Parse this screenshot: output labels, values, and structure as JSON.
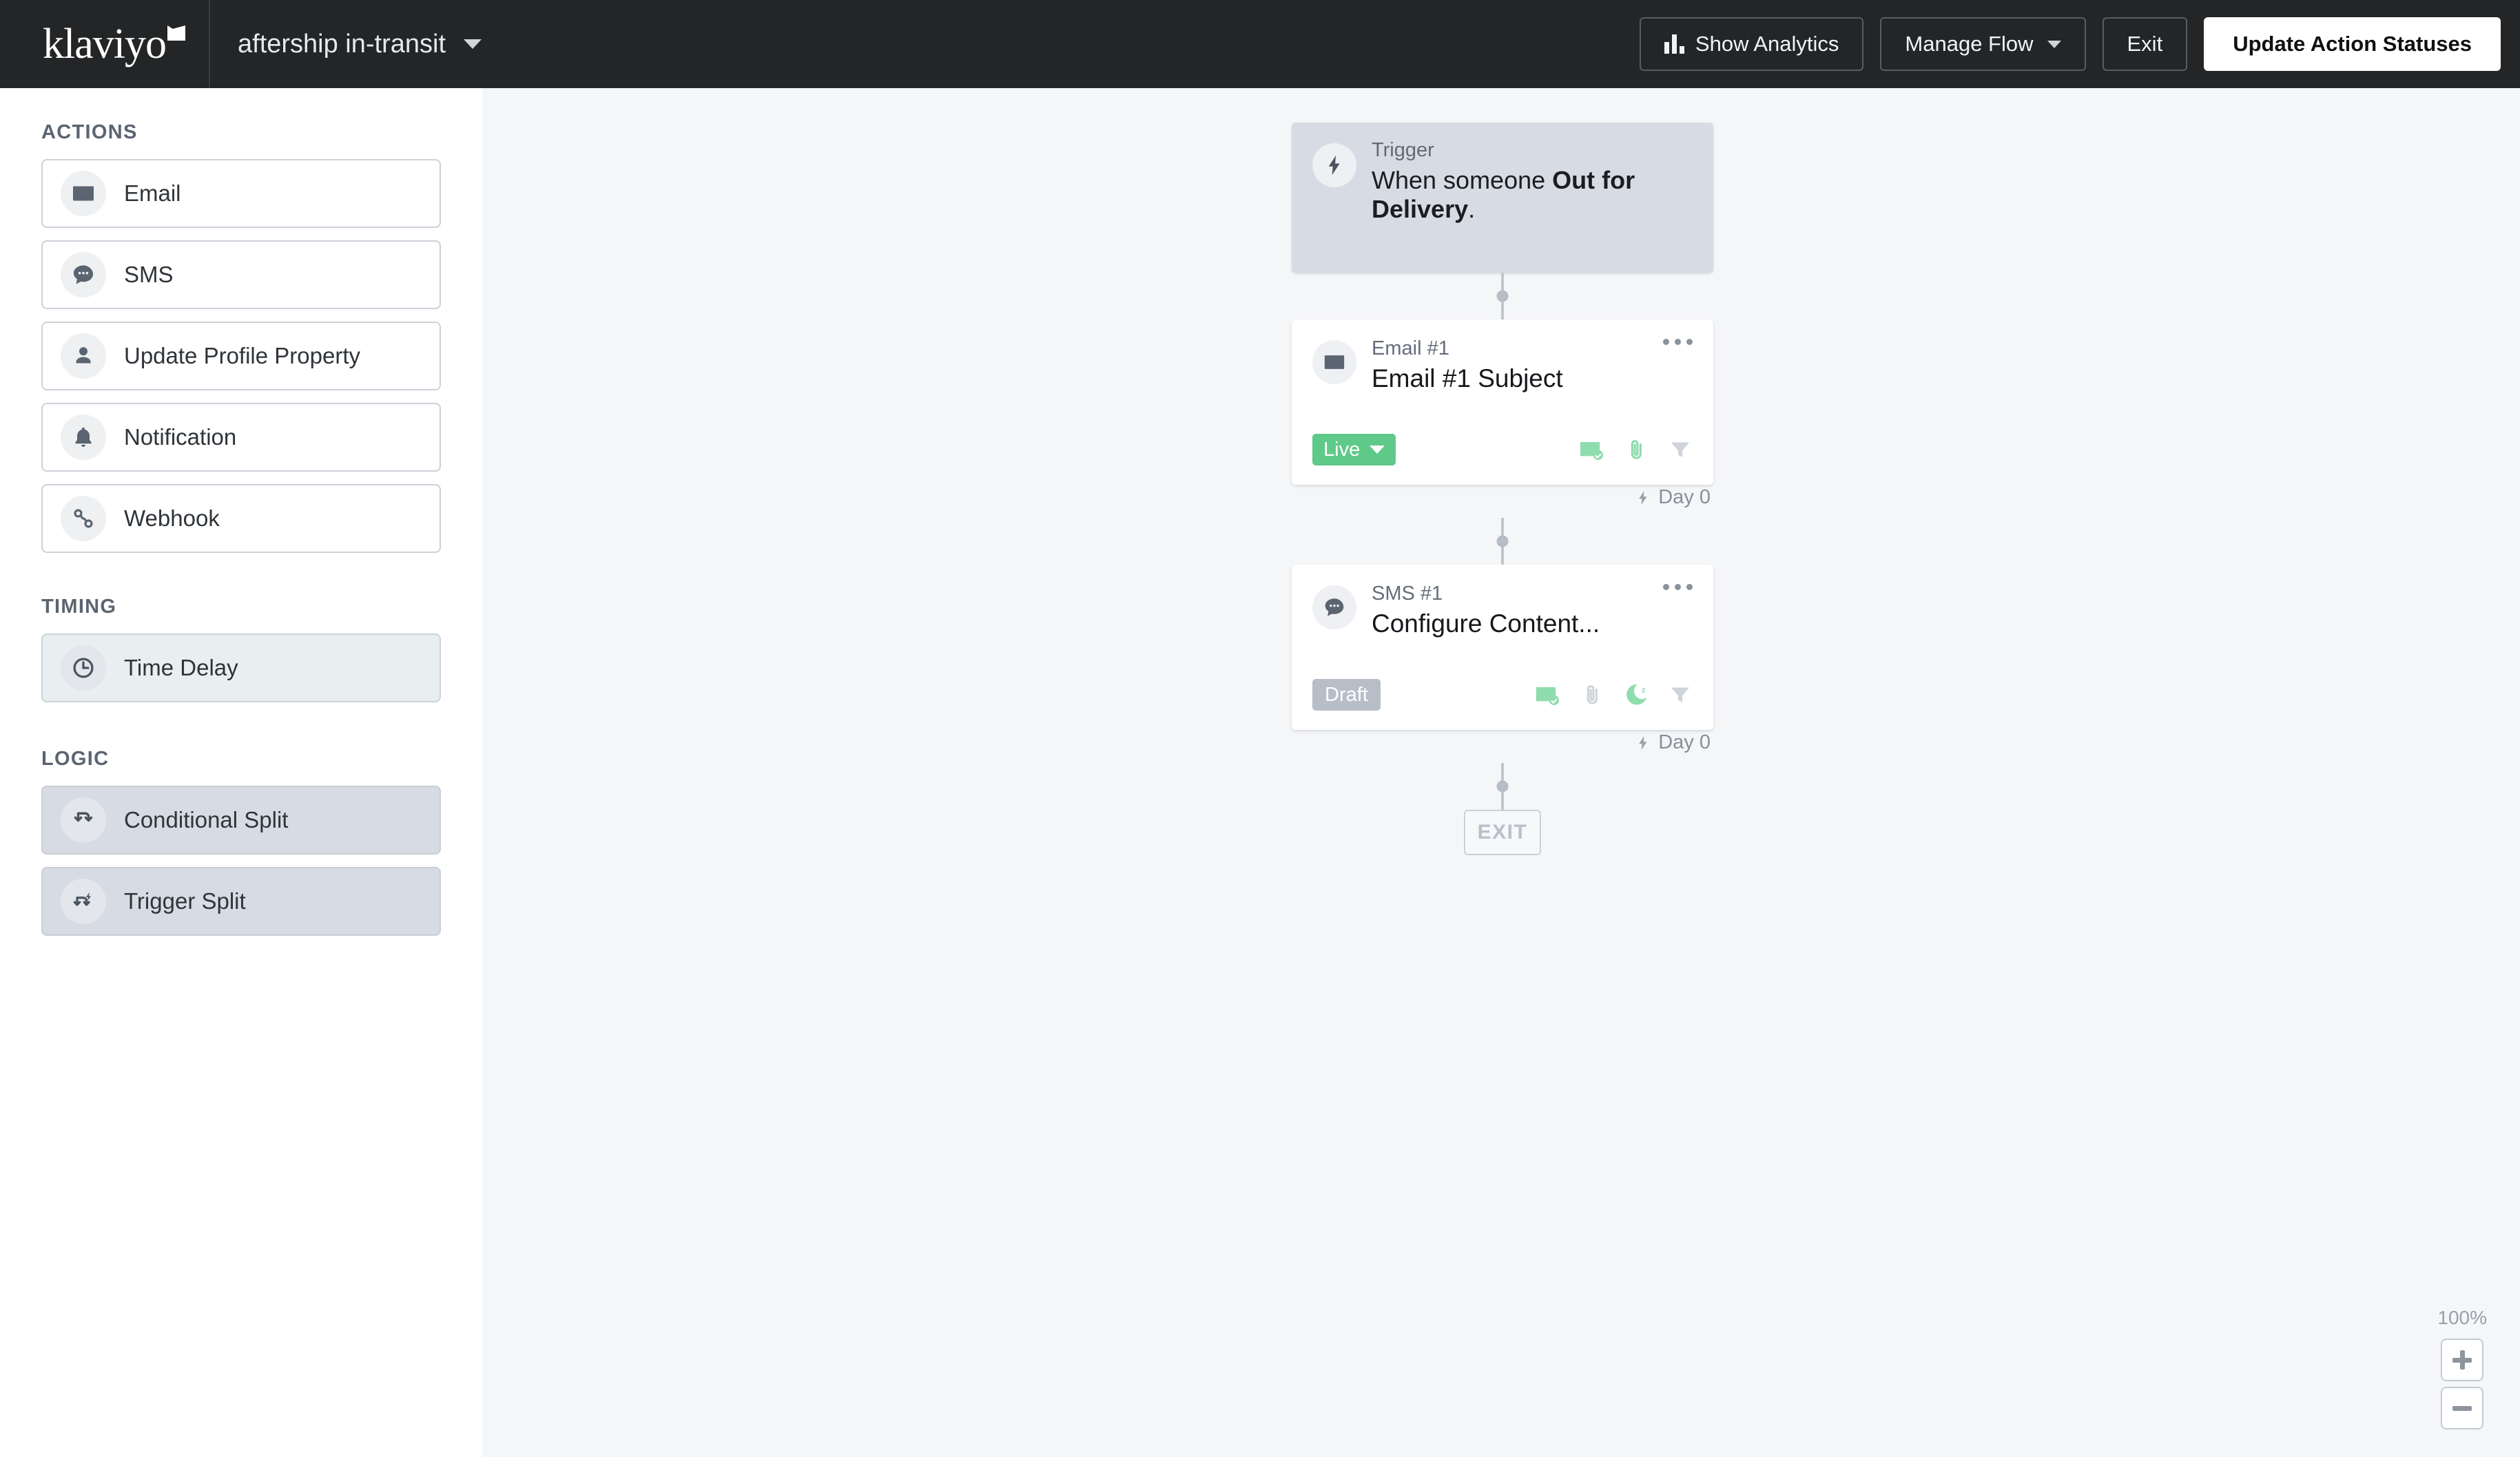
{
  "header": {
    "logo_text": "klaviyo",
    "flow_name": "aftership in-transit",
    "flow_caret_icon": "chevron-down-icon",
    "buttons": {
      "show_analytics": "Show Analytics",
      "analytics_icon": "bar-chart-icon",
      "manage_flow": "Manage Flow",
      "manage_flow_caret_icon": "chevron-down-icon",
      "exit": "Exit",
      "update_action_statuses": "Update Action Statuses"
    }
  },
  "sidebar": {
    "sections": [
      {
        "label": "ACTIONS",
        "items": [
          {
            "label": "Email",
            "icon": "envelope-icon",
            "style": "plain"
          },
          {
            "label": "SMS",
            "icon": "chat-bubble-icon",
            "style": "plain"
          },
          {
            "label": "Update Profile Property",
            "icon": "person-icon",
            "style": "plain"
          },
          {
            "label": "Notification",
            "icon": "bell-icon",
            "style": "plain"
          },
          {
            "label": "Webhook",
            "icon": "webhook-icon",
            "style": "plain"
          }
        ]
      },
      {
        "label": "TIMING",
        "items": [
          {
            "label": "Time Delay",
            "icon": "clock-icon",
            "style": "tinted"
          }
        ]
      },
      {
        "label": "LOGIC",
        "items": [
          {
            "label": "Conditional Split",
            "icon": "conditional-split-icon",
            "style": "tinted2"
          },
          {
            "label": "Trigger Split",
            "icon": "trigger-split-icon",
            "style": "tinted2"
          }
        ]
      }
    ]
  },
  "flow": {
    "trigger": {
      "kicker": "Trigger",
      "icon": "lightning-bolt-icon",
      "text_prefix": "When someone ",
      "text_strong": "Out for Delivery",
      "text_suffix": "."
    },
    "nodes": [
      {
        "kicker": "Email #1",
        "icon": "envelope-icon",
        "title": "Email #1 Subject",
        "status": "Live",
        "status_type": "live",
        "status_has_caret": true,
        "icons": [
          "smart-sending-icon",
          "attachment-icon",
          "filter-icon"
        ],
        "icon_states": [
          "green",
          "green",
          "gray"
        ],
        "day_label": "Day 0",
        "day_icon": "lightning-bolt-icon",
        "menu_icon": "more-options-icon"
      },
      {
        "kicker": "SMS #1",
        "icon": "chat-bubble-icon",
        "title": "Configure Content...",
        "status": "Draft",
        "status_type": "draft",
        "status_has_caret": false,
        "icons": [
          "smart-sending-icon",
          "attachment-icon",
          "quiet-hours-icon",
          "filter-icon"
        ],
        "icon_states": [
          "green",
          "gray",
          "green",
          "gray"
        ],
        "day_label": "Day 0",
        "day_icon": "lightning-bolt-icon",
        "menu_icon": "more-options-icon"
      }
    ],
    "exit_label": "EXIT"
  },
  "zoom": {
    "percent": "100%",
    "zoom_in_icon": "plus-icon",
    "zoom_out_icon": "minus-icon"
  },
  "colors": {
    "header_bg": "#242527",
    "canvas_bg": "#f5f6f8",
    "trigger_bg": "#d7dce4",
    "live_green": "#5fc98a",
    "draft_gray": "#b7bec8",
    "icon_gray": "#5b6471"
  }
}
